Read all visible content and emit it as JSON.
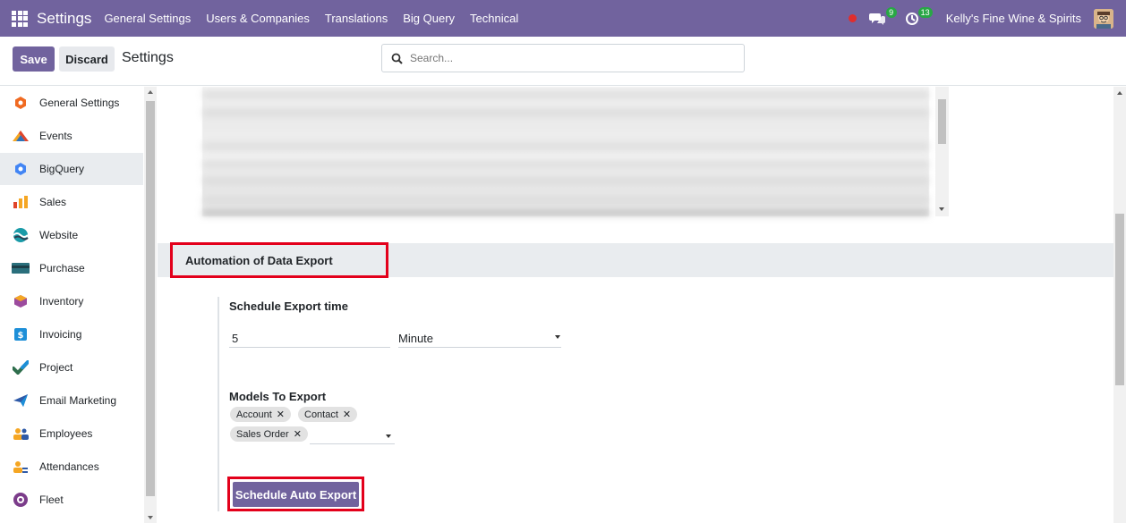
{
  "navbar": {
    "app_title": "Settings",
    "menu": [
      "General Settings",
      "Users & Companies",
      "Translations",
      "Big Query",
      "Technical"
    ],
    "messages_badge": "9",
    "activities_badge": "13",
    "company": "Kelly's Fine Wine & Spirits"
  },
  "control_panel": {
    "save_label": "Save",
    "discard_label": "Discard",
    "title": "Settings",
    "search_placeholder": "Search..."
  },
  "sidebar": {
    "items": [
      {
        "label": "General Settings",
        "icon": "general-settings-icon",
        "color": "#f06a21"
      },
      {
        "label": "Events",
        "icon": "events-icon",
        "color": "#f05a28"
      },
      {
        "label": "BigQuery",
        "icon": "bigquery-icon",
        "color": "#4285f4",
        "active": true
      },
      {
        "label": "Sales",
        "icon": "sales-icon",
        "color": "#f5a623"
      },
      {
        "label": "Website",
        "icon": "website-icon",
        "color": "#1a9ba8"
      },
      {
        "label": "Purchase",
        "icon": "purchase-icon",
        "color": "#2a6f7c"
      },
      {
        "label": "Inventory",
        "icon": "inventory-icon",
        "color": "#9c4b9e"
      },
      {
        "label": "Invoicing",
        "icon": "invoicing-icon",
        "color": "#1d8fd8"
      },
      {
        "label": "Project",
        "icon": "project-icon",
        "color": "#2f6e4d"
      },
      {
        "label": "Email Marketing",
        "icon": "email-marketing-icon",
        "color": "#2e5aa8"
      },
      {
        "label": "Employees",
        "icon": "employees-icon",
        "color": "#f5a623"
      },
      {
        "label": "Attendances",
        "icon": "attendances-icon",
        "color": "#f5a623"
      },
      {
        "label": "Fleet",
        "icon": "fleet-icon",
        "color": "#7b3c8a"
      }
    ]
  },
  "section": {
    "title": "Automation of Data Export"
  },
  "schedule": {
    "label": "Schedule Export time",
    "interval_value": "5",
    "interval_unit": "Minute"
  },
  "models": {
    "label": "Models To Export",
    "tags": [
      "Account",
      "Contact",
      "Sales Order"
    ]
  },
  "schedule_button_label": "Schedule Auto Export",
  "colors": {
    "brand": "#71639e",
    "highlight": "#e3001b"
  }
}
